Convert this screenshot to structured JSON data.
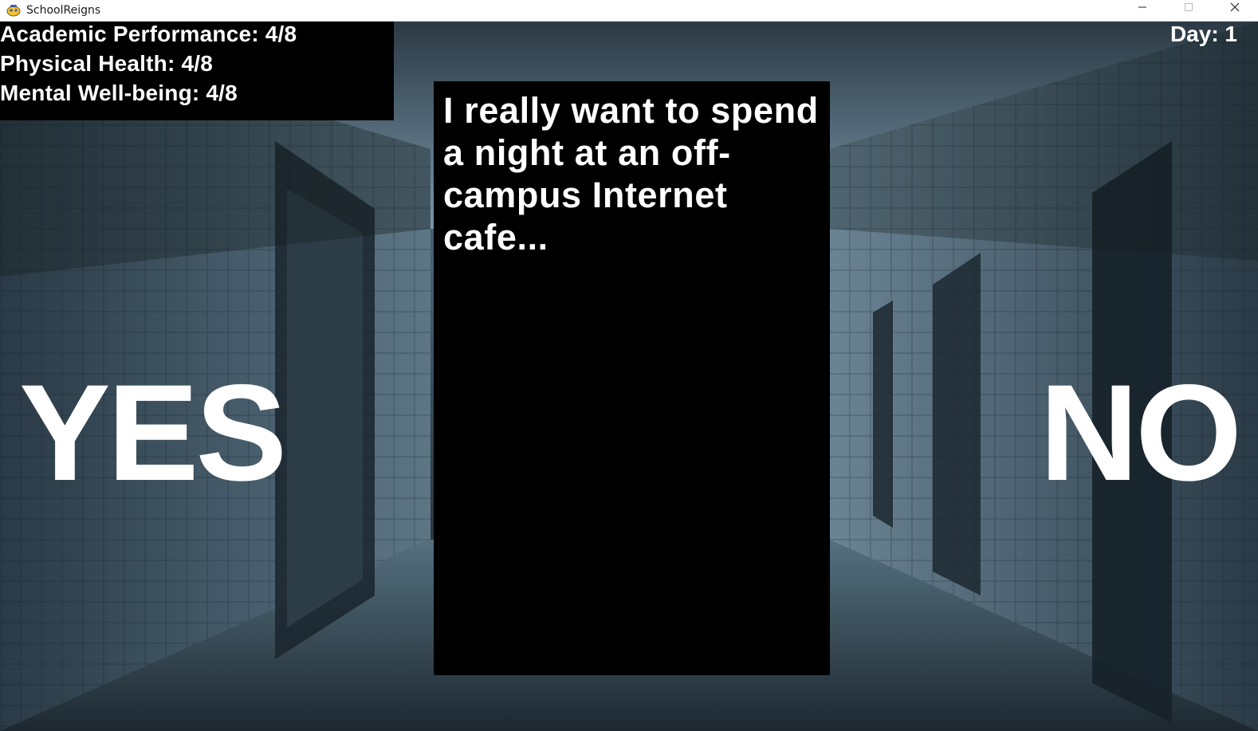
{
  "window": {
    "title": "SchoolReigns",
    "app_icon": "game-controller-icon",
    "controls": [
      "minimize-icon",
      "maximize-icon",
      "close-icon"
    ]
  },
  "stats": {
    "academic": "Academic Performance: 4/8",
    "physical": "Physical Health: 4/8",
    "mental": "Mental Well-being: 4/8"
  },
  "day": "Day: 1",
  "card": {
    "text": "I really want to spend a night at an off-campus Internet cafe..."
  },
  "choices": {
    "yes": "YES",
    "no": "NO"
  },
  "colors": {
    "panel": "#000000",
    "text": "#ffffff",
    "titlebar": "#ffffff"
  }
}
